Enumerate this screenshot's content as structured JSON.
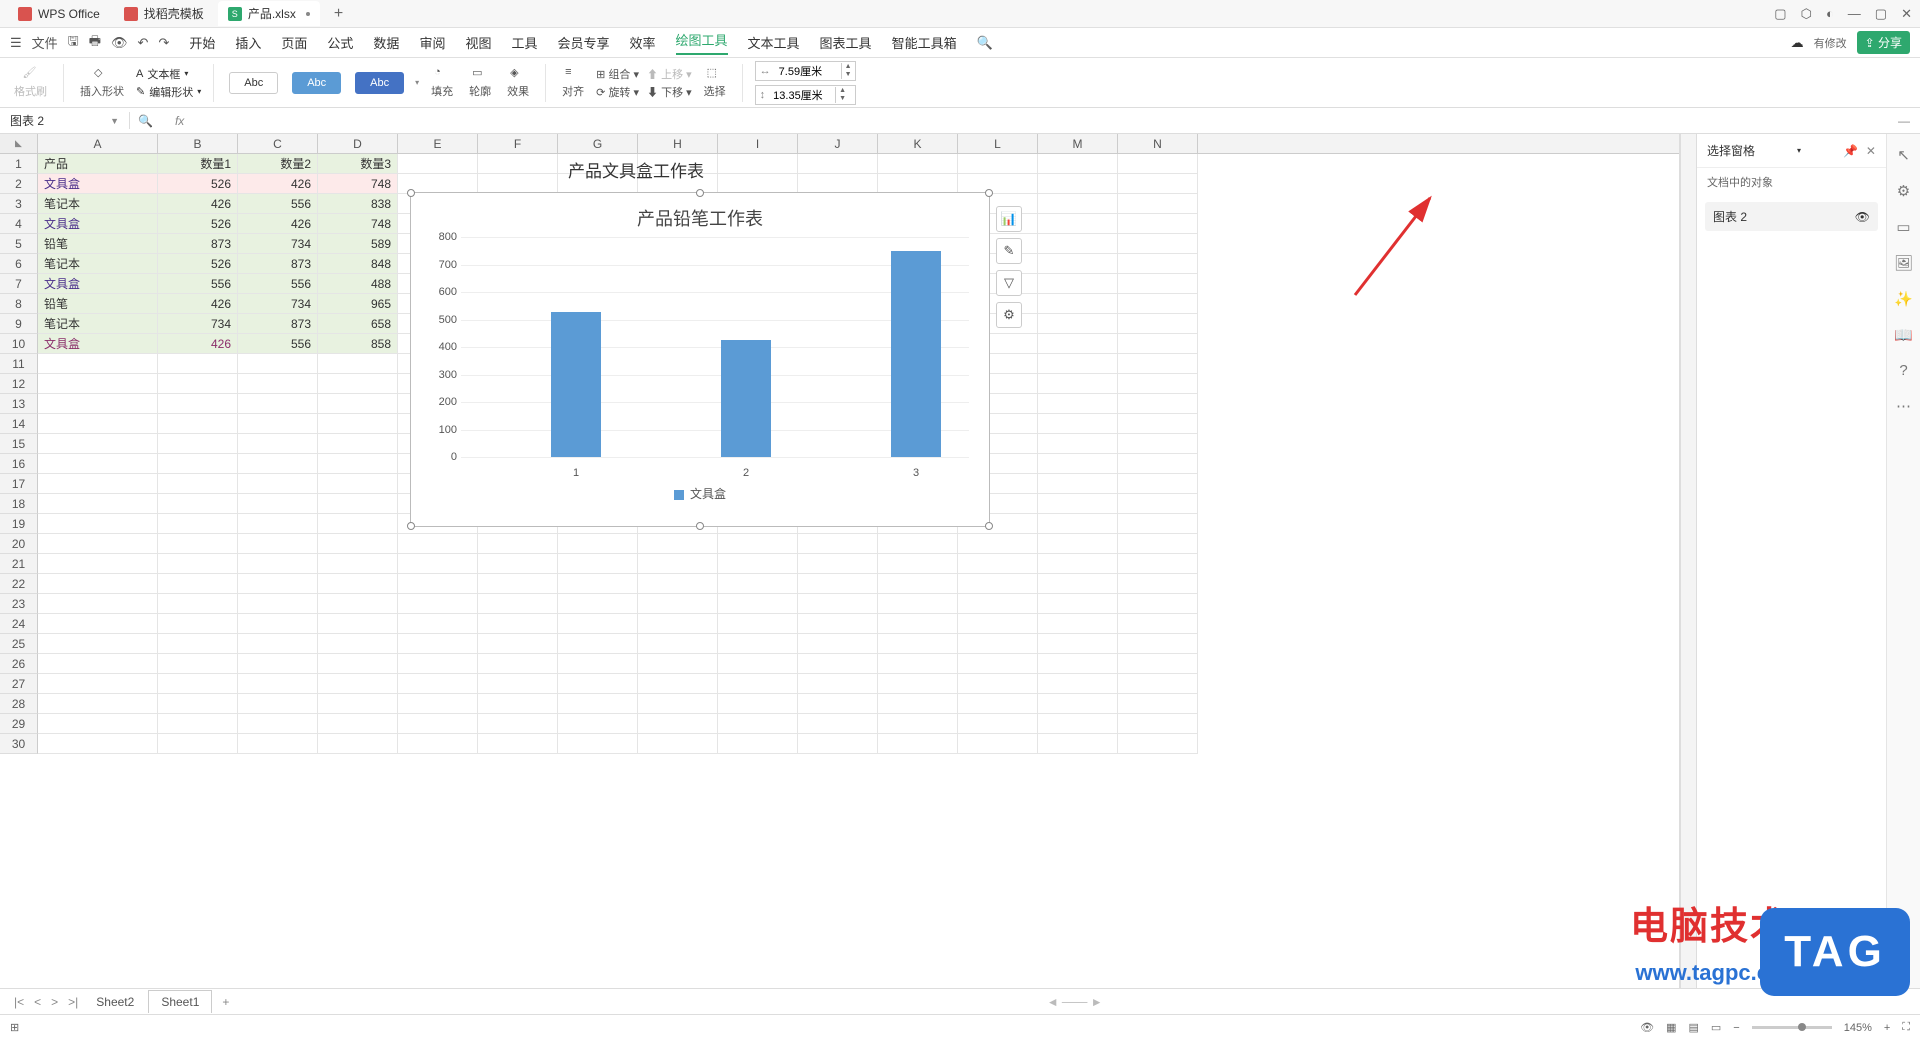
{
  "titlebar": {
    "app_name": "WPS Office",
    "template_tab": "找稻壳模板",
    "doc_tab": "产品.xlsx",
    "doc_badge": "S",
    "plus": "+"
  },
  "menus": {
    "file": "文件",
    "items": [
      "开始",
      "插入",
      "页面",
      "公式",
      "数据",
      "审阅",
      "视图",
      "工具",
      "会员专享",
      "效率",
      "绘图工具",
      "文本工具",
      "图表工具",
      "智能工具箱"
    ],
    "active": "绘图工具",
    "modified": "有修改",
    "share": "分享"
  },
  "ribbon": {
    "format_painter": "格式刷",
    "insert_shape": "插入形状",
    "text_box": "文本框",
    "edit_shape": "编辑形状",
    "abc": "Abc",
    "fill": "填充",
    "outline": "轮廓",
    "effects": "效果",
    "align": "对齐",
    "group": "组合",
    "rotate": "旋转",
    "move_up": "上移",
    "move_down": "下移",
    "select": "选择",
    "width_label": "7.59厘米",
    "height_label": "13.35厘米"
  },
  "namebox": "图表 2",
  "fx_label": "fx",
  "columns": [
    "A",
    "B",
    "C",
    "D",
    "E",
    "F",
    "G",
    "H",
    "I",
    "J",
    "K",
    "L",
    "M",
    "N"
  ],
  "headers": {
    "A": "产品",
    "B": "数量1",
    "C": "数量2",
    "D": "数量3"
  },
  "table": [
    {
      "A": "文具盒",
      "B": 526,
      "C": 426,
      "D": 748
    },
    {
      "A": "笔记本",
      "B": 426,
      "C": 556,
      "D": 838
    },
    {
      "A": "文具盒",
      "B": 526,
      "C": 426,
      "D": 748
    },
    {
      "A": "铅笔",
      "B": 873,
      "C": 734,
      "D": 589
    },
    {
      "A": "笔记本",
      "B": 526,
      "C": 873,
      "D": 848
    },
    {
      "A": "文具盒",
      "B": 556,
      "C": 556,
      "D": 488
    },
    {
      "A": "铅笔",
      "B": 426,
      "C": 734,
      "D": 965
    },
    {
      "A": "笔记本",
      "B": 734,
      "C": 873,
      "D": 658
    },
    {
      "A": "文具盒",
      "B": 426,
      "C": 556,
      "D": 858
    }
  ],
  "chart1_title": "产品文具盒工作表",
  "chart_data": {
    "type": "bar",
    "title": "产品铅笔工作表",
    "categories": [
      "1",
      "2",
      "3"
    ],
    "values": [
      526,
      426,
      748
    ],
    "series_name": "文具盒",
    "ylim": [
      0,
      800
    ],
    "yticks": [
      0,
      100,
      200,
      300,
      400,
      500,
      600,
      700,
      800
    ],
    "xlabel": "",
    "ylabel": ""
  },
  "selection_pane": {
    "title": "选择窗格",
    "subtitle": "文档中的对象",
    "item": "图表 2"
  },
  "sheets": {
    "s1": "Sheet2",
    "s2": "Sheet1"
  },
  "status": {
    "zoom": "145%"
  },
  "watermark": {
    "txt1": "电脑技术网",
    "txt2": "www.tagpc.com",
    "tag": "TAG"
  }
}
